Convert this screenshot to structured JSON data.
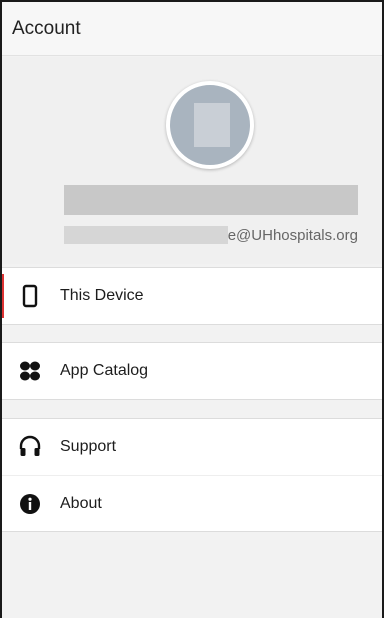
{
  "header": {
    "title": "Account"
  },
  "profile": {
    "email_domain": "e@UHhospitals.org"
  },
  "menu": {
    "device": {
      "label": "This Device",
      "icon": "phone-icon"
    },
    "catalog": {
      "label": "App Catalog",
      "icon": "apps-icon"
    },
    "support": {
      "label": "Support",
      "icon": "headphones-icon"
    },
    "about": {
      "label": "About",
      "icon": "info-icon"
    }
  },
  "colors": {
    "accent_active": "#dd3333",
    "background": "#f2f2f2",
    "avatar": "#a9b4bf"
  }
}
